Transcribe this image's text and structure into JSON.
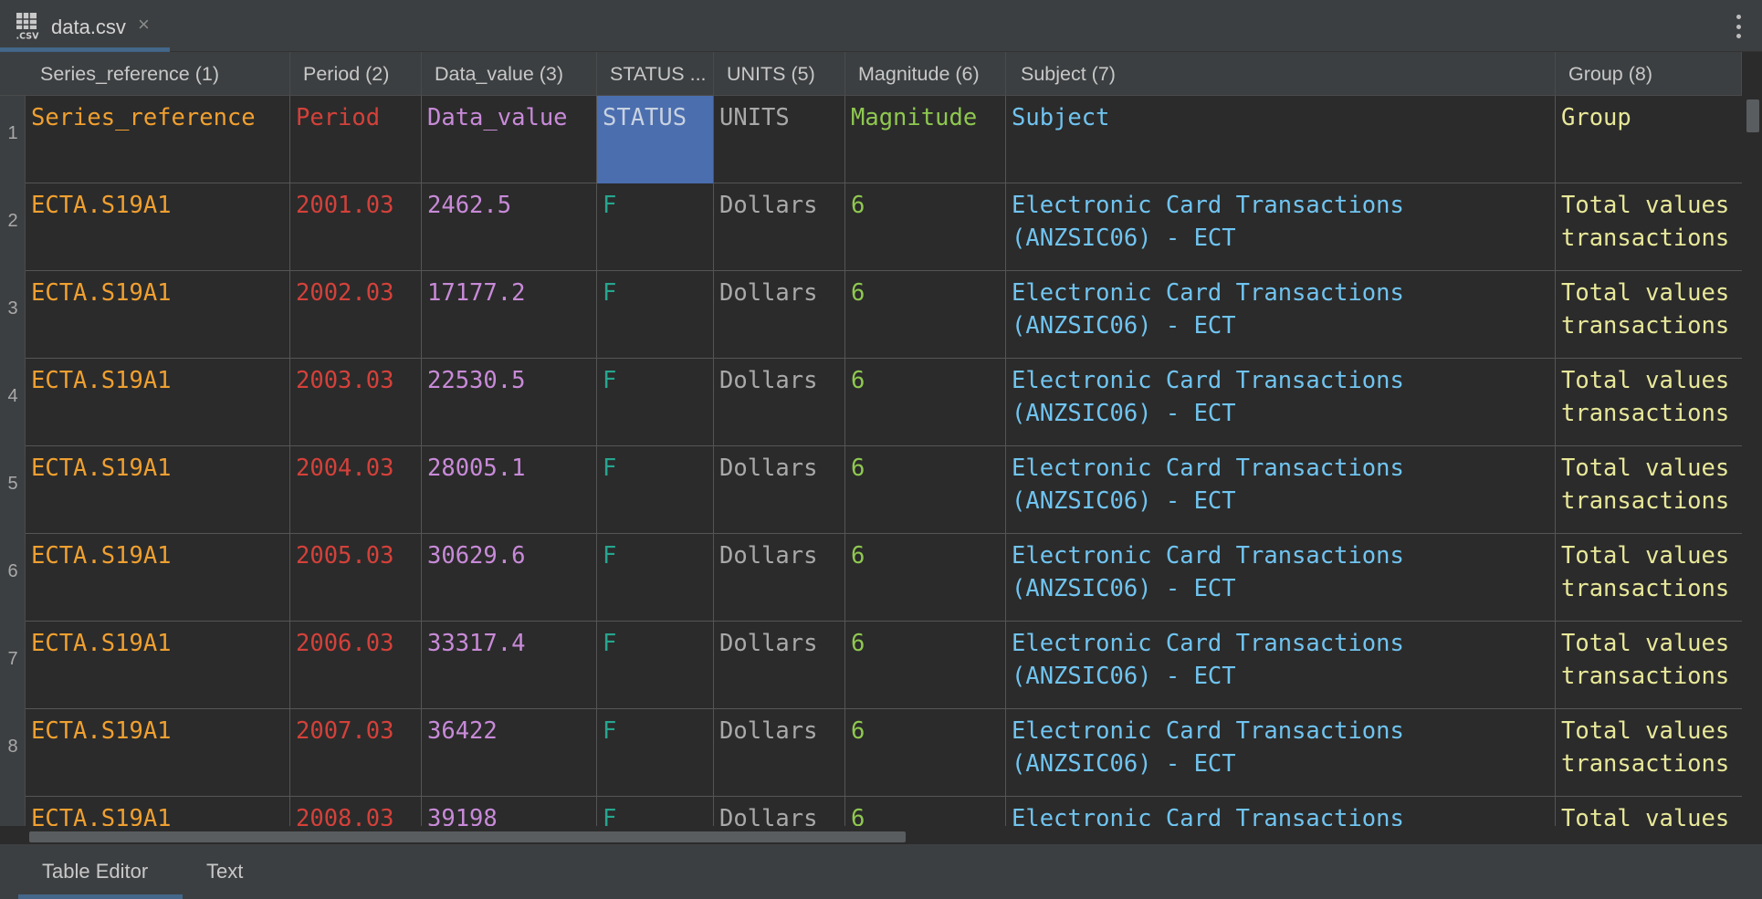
{
  "tab": {
    "title": "data.csv",
    "close_glyph": "×",
    "icon": "csv-file-icon",
    "icon_label": ".CSV"
  },
  "more_menu": {
    "icon": "more-vertical-icon"
  },
  "columns": [
    {
      "label": "Series_reference (1)"
    },
    {
      "label": "Period (2)"
    },
    {
      "label": "Data_value (3)"
    },
    {
      "label": "STATUS ..."
    },
    {
      "label": "UNITS (5)"
    },
    {
      "label": "Magnitude (6)"
    },
    {
      "label": "Subject (7)"
    },
    {
      "label": "Group (8)"
    }
  ],
  "header_row": {
    "number": "1",
    "cells": [
      "Series_reference",
      "Period",
      "Data_value",
      "STATUS",
      "UNITS",
      "Magnitude",
      "Subject",
      "Group"
    ]
  },
  "rows": [
    {
      "number": "2",
      "series": "ECTA.S19A1",
      "period": "2001.03",
      "value": "2462.5",
      "status": "F",
      "units": "Dollars",
      "magnitude": "6",
      "subject_1": "Electronic Card Transactions",
      "subject_2": "(ANZSIC06) - ECT",
      "group_1": "Total values",
      "group_2": "transactions"
    },
    {
      "number": "3",
      "series": "ECTA.S19A1",
      "period": "2002.03",
      "value": "17177.2",
      "status": "F",
      "units": "Dollars",
      "magnitude": "6",
      "subject_1": "Electronic Card Transactions",
      "subject_2": "(ANZSIC06) - ECT",
      "group_1": "Total values",
      "group_2": "transactions"
    },
    {
      "number": "4",
      "series": "ECTA.S19A1",
      "period": "2003.03",
      "value": "22530.5",
      "status": "F",
      "units": "Dollars",
      "magnitude": "6",
      "subject_1": "Electronic Card Transactions",
      "subject_2": "(ANZSIC06) - ECT",
      "group_1": "Total values",
      "group_2": "transactions"
    },
    {
      "number": "5",
      "series": "ECTA.S19A1",
      "period": "2004.03",
      "value": "28005.1",
      "status": "F",
      "units": "Dollars",
      "magnitude": "6",
      "subject_1": "Electronic Card Transactions",
      "subject_2": "(ANZSIC06) - ECT",
      "group_1": "Total values",
      "group_2": "transactions"
    },
    {
      "number": "6",
      "series": "ECTA.S19A1",
      "period": "2005.03",
      "value": "30629.6",
      "status": "F",
      "units": "Dollars",
      "magnitude": "6",
      "subject_1": "Electronic Card Transactions",
      "subject_2": "(ANZSIC06) - ECT",
      "group_1": "Total values",
      "group_2": "transactions"
    },
    {
      "number": "7",
      "series": "ECTA.S19A1",
      "period": "2006.03",
      "value": "33317.4",
      "status": "F",
      "units": "Dollars",
      "magnitude": "6",
      "subject_1": "Electronic Card Transactions",
      "subject_2": "(ANZSIC06) - ECT",
      "group_1": "Total values",
      "group_2": "transactions"
    },
    {
      "number": "8",
      "series": "ECTA.S19A1",
      "period": "2007.03",
      "value": "36422",
      "status": "F",
      "units": "Dollars",
      "magnitude": "6",
      "subject_1": "Electronic Card Transactions",
      "subject_2": "(ANZSIC06) - ECT",
      "group_1": "Total values",
      "group_2": "transactions"
    },
    {
      "number": "",
      "series": "ECTA.S19A1",
      "period": "2008.03",
      "value": "39198",
      "status": "F",
      "units": "Dollars",
      "magnitude": "6",
      "subject_1": "Electronic Card Transactions",
      "subject_2": "",
      "group_1": "Total values",
      "group_2": ""
    }
  ],
  "bottom_tabs": {
    "table_editor": "Table Editor",
    "text": "Text"
  },
  "colors": {
    "series": "#f0a030",
    "period": "#d4413a",
    "value": "#c88ad8",
    "status": "#26a68f",
    "units": "#a9a9a9",
    "magnitude": "#8fc850",
    "subject": "#70c4f0",
    "group": "#e8e89a",
    "selection": "#4b6eaf"
  }
}
